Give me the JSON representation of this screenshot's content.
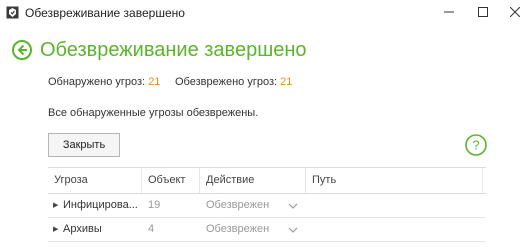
{
  "window": {
    "title": "Обезвреживание завершено"
  },
  "header": {
    "title": "Обезвреживание завершено"
  },
  "stats": {
    "detected_label": "Обнаружено угроз:",
    "detected_value": "21",
    "neutralized_label": "Обезврежено угроз:",
    "neutralized_value": "21"
  },
  "message": "Все обнаруженные угрозы обезврежены.",
  "buttons": {
    "close_label": "Закрыть"
  },
  "table": {
    "headers": [
      "Угроза",
      "Объект",
      "Действие",
      "Путь"
    ],
    "rows": [
      {
        "threat": "Инфицирова...",
        "object": "19",
        "action": "Обезврежен",
        "path": ""
      },
      {
        "threat": "Архивы",
        "object": "4",
        "action": "Обезврежен",
        "path": ""
      }
    ]
  },
  "icons": {
    "app": "shield-app-icon",
    "back": "back-arrow-icon",
    "help": "help-icon",
    "expand": "expand-triangle-icon",
    "dropdown": "chevron-down-icon"
  },
  "colors": {
    "accent_green": "#5ab52a",
    "number_orange": "#e58b1d"
  }
}
